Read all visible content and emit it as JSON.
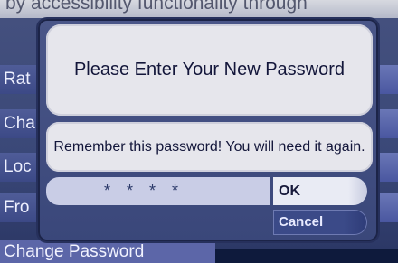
{
  "background": {
    "top_text": "by accessibility functionality through",
    "menu": [
      "Rat",
      "Cha",
      "Loc",
      "Fro"
    ],
    "bottom_tab_label": "Change Password"
  },
  "dialog": {
    "title": "Please Enter Your New Password",
    "message": "Remember this password!  You will need it again.",
    "password_mask": "****",
    "ok_label": "OK",
    "cancel_label": "Cancel"
  },
  "colors": {
    "dialog_bg": "#3e4a7c",
    "box_bg": "#e6e6ec",
    "field_bg": "#c9cde6",
    "menu_bg": "#4a5796",
    "bottom_tab_bg": "#5c66a8"
  }
}
